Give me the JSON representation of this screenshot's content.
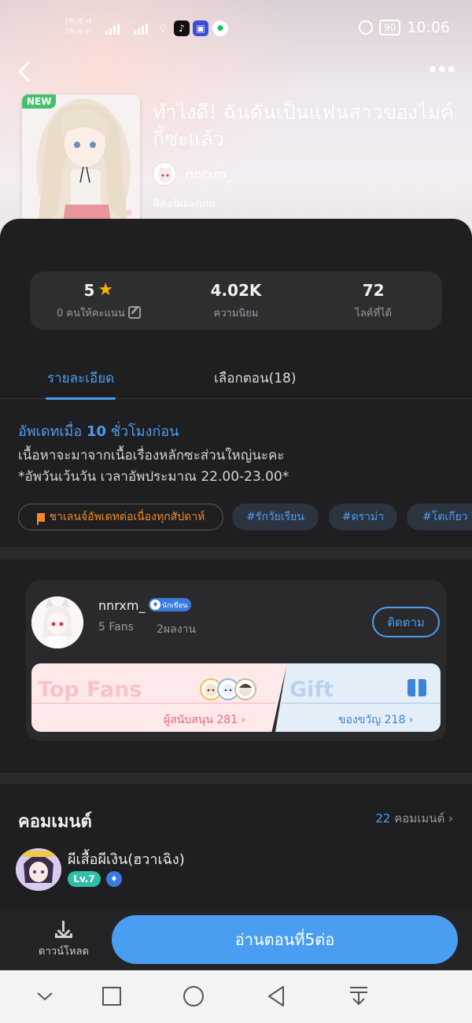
{
  "status_bar": {
    "carrier_line1": "TRUE-H",
    "carrier_line2": "TRUE-H",
    "battery": "90",
    "time": "10:06"
  },
  "novel": {
    "badge": "NEW",
    "title": "ทำไงดี! ฉันดันเป็นแฟนสาวของไมค์กี้ซะแล้ว",
    "author": "nnrxm_",
    "genre": "ฟิคอนิเมะ/เกม"
  },
  "stats": {
    "rating_value": "5",
    "rating_label": "0 คนให้คะแนน",
    "popularity_value": "4.02K",
    "popularity_label": "ความนิยม",
    "likes_value": "72",
    "likes_label": "ไลค์ที่ได้"
  },
  "tabs": {
    "details": "รายละเอียด",
    "episodes": "เลือกตอน(18)"
  },
  "details": {
    "update_prefix": "อัพเดทเมื่อ",
    "update_number": "10",
    "update_suffix": "ชั่วโมงก่อน",
    "desc_line1": "เนื้อหาจะมาจากเนื้อเรื่องหลักซะส่วนใหญ่นะคะ",
    "desc_line2": "*อัพวันเว้นวัน   เวลาอัพประมาณ 22.00-23.00*"
  },
  "tags": {
    "challenge": "ชาเลนจ์อัพเดทต่อเนื่องทุกสัปดาห์",
    "tag1": "#รักวัยเรียน",
    "tag2": "#ดราม่า",
    "tag3": "#โตเกียว รี"
  },
  "author_card": {
    "name": "nnrxm_",
    "badge": "นักเขียน",
    "fans": "5 Fans",
    "works": "2ผลงาน",
    "follow": "ติดตาม",
    "top_fans_title": "Top Fans",
    "top_fans_sub": "ผู้สนับสนุน 281",
    "gift_title": "Gift",
    "gift_sub": "ของขวัญ 218"
  },
  "comments": {
    "title": "คอมเมนต์",
    "count_number": "22",
    "count_label": "คอมเมนต์",
    "first_user": "ผีเสื้อผีเงิน(ฮวาเฉิง)",
    "first_level": "Lv.7"
  },
  "bottom": {
    "download": "ดาวน์โหลด",
    "read_button": "อ่านตอนที่5ต่อ"
  },
  "colors": {
    "accent": "#4a9ef1",
    "background": "#1e1e20",
    "challenge_orange": "#f08a28",
    "new_badge_green": "#46c06f",
    "star": "#f4b400"
  }
}
